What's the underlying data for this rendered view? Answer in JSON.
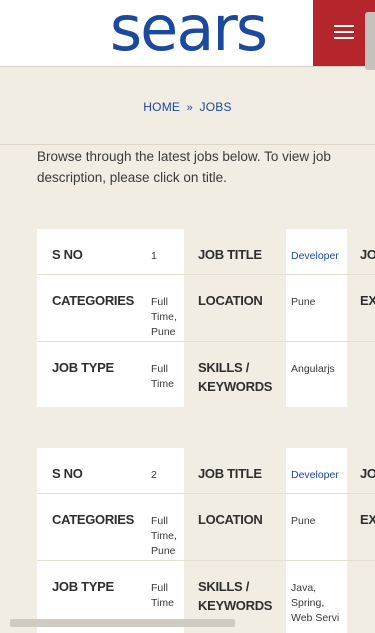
{
  "header": {
    "logo_text": "sears",
    "menu_label": ""
  },
  "breadcrumb": {
    "home": "HOME",
    "current": "JOBS"
  },
  "intro": "Browse through the latest jobs below. To view job description, please click on title.",
  "labels": {
    "sno": "S NO",
    "job_title": "JOB TITLE",
    "job_type_short": "JO",
    "categories": "CATEGORIES",
    "location": "LOCATION",
    "experience_short": "EX",
    "job_type": "JOB TYPE",
    "skills": "SKILLS / KEYWORDS"
  },
  "jobs": [
    {
      "sno": "1",
      "title": "Developer",
      "categories": "Full Time, Pune",
      "location": "Pune",
      "job_type": "Full Time",
      "skills": "Angularjs"
    },
    {
      "sno": "2",
      "title": "Developer",
      "categories": "Full Time, Pune",
      "location": "Pune",
      "job_type": "Full Time",
      "skills": "Java, Spring, Web Servi"
    }
  ]
}
